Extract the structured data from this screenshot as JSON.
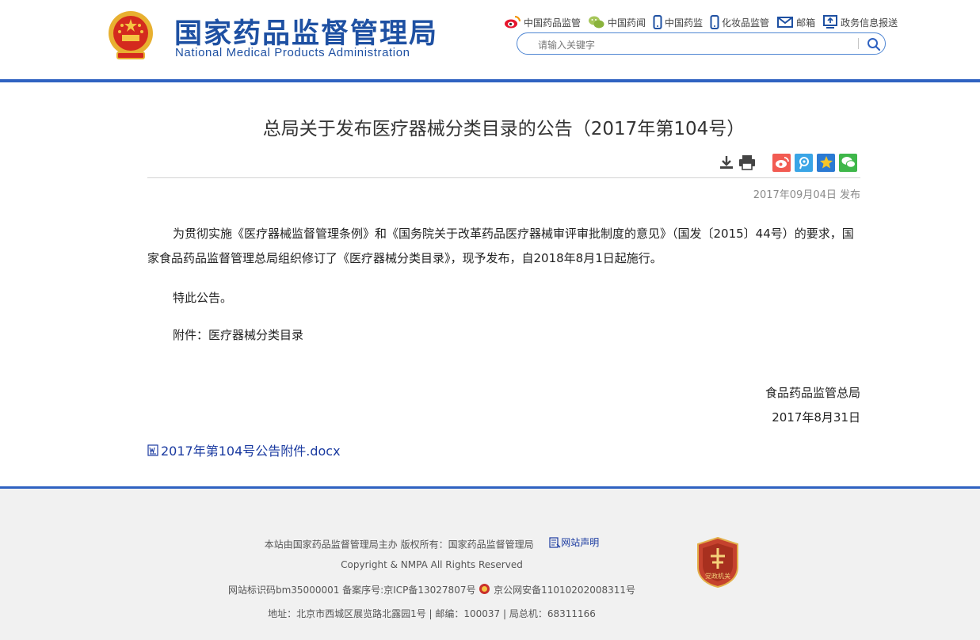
{
  "header": {
    "logo_cn": "国家药品监督管理局",
    "logo_en": "National Medical Products Administration",
    "top_links": [
      "中国药品监管",
      "中国药闻",
      "中国药监",
      "化妆品监管",
      "邮箱",
      "政务信息报送"
    ],
    "search_placeholder": "请输入关键字"
  },
  "article": {
    "title": "总局关于发布医疗器械分类目录的公告（2017年第104号）",
    "date": "2017年09月04日 发布",
    "paragraphs": [
      "为贯彻实施《医疗器械监督管理条例》和《国务院关于改革药品医疗器械审评审批制度的意见》（国发〔2015〕44号）的要求，国家食品药品监督管理总局组织修订了《医疗器械分类目录》，现予发布，自2018年8月1日起施行。",
      "特此公告。",
      "附件：医疗器械分类目录"
    ],
    "signature_org": "食品药品监管总局",
    "signature_date": "2017年8月31日",
    "attachment": "2017年第104号公告附件.docx"
  },
  "footer": {
    "sponsor": "本站由国家药品监督管理局主办  版权所有：国家药品监督管理局",
    "statement_link": "网站声明",
    "copyright": "Copyright & NMPA All Rights Reserved",
    "icp": "网站标识码bm35000001 备案序号:京ICP备13027807号",
    "police": "京公网安备11010202008311号",
    "address": "地址：北京市西城区展览路北露园1号 | 邮编：100037 | 局总机：68311166",
    "badge_text": "党政机关"
  },
  "colors": {
    "brand_blue": "#1e50a2",
    "bar_blue": "#2f62c1",
    "link_blue": "#1a3aa0"
  }
}
